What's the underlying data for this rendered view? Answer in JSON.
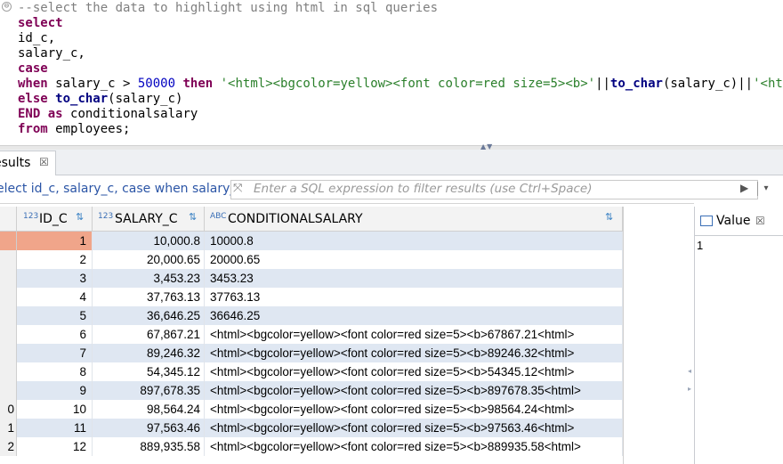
{
  "editor": {
    "fold_symbol": "⊖",
    "lines": [
      {
        "segments": [
          {
            "t": "--select the data to highlight using html in sql queries",
            "c": "c-comment"
          }
        ]
      },
      {
        "segments": [
          {
            "t": "select",
            "c": "c-kw"
          }
        ]
      },
      {
        "segments": [
          {
            "t": "id_c,",
            "c": "c-plain"
          }
        ]
      },
      {
        "segments": [
          {
            "t": "salary_c,",
            "c": "c-plain"
          }
        ]
      },
      {
        "segments": [
          {
            "t": "case",
            "c": "c-kw"
          }
        ]
      },
      {
        "segments": [
          {
            "t": "when",
            "c": "c-kw"
          },
          {
            "t": " salary_c > ",
            "c": "c-plain"
          },
          {
            "t": "50000",
            "c": "c-num"
          },
          {
            "t": " ",
            "c": "c-plain"
          },
          {
            "t": "then",
            "c": "c-kw"
          },
          {
            "t": " ",
            "c": "c-plain"
          },
          {
            "t": "'<html><bgcolor=yellow><font color=red size=5><b>'",
            "c": "c-str"
          },
          {
            "t": "||",
            "c": "c-plain"
          },
          {
            "t": "to_char",
            "c": "c-fn"
          },
          {
            "t": "(salary_c)||",
            "c": "c-plain"
          },
          {
            "t": "'<html>'",
            "c": "c-str"
          }
        ]
      },
      {
        "segments": [
          {
            "t": "else",
            "c": "c-kw"
          },
          {
            "t": " ",
            "c": "c-plain"
          },
          {
            "t": "to_char",
            "c": "c-fn"
          },
          {
            "t": "(salary_c)",
            "c": "c-plain"
          }
        ]
      },
      {
        "segments": [
          {
            "t": "END",
            "c": "c-kw"
          },
          {
            "t": " ",
            "c": "c-plain"
          },
          {
            "t": "as",
            "c": "c-kw"
          },
          {
            "t": " conditionalsalary",
            "c": "c-plain"
          }
        ]
      },
      {
        "segments": [
          {
            "t": "from",
            "c": "c-kw"
          },
          {
            "t": " employees;",
            "c": "c-plain"
          }
        ]
      }
    ]
  },
  "results_tab": {
    "label": "esults",
    "close": "☒"
  },
  "filter": {
    "query_text": "elect id_c, salary_c, case when salary_c",
    "filter_icon": "⤧",
    "placeholder": "Enter a SQL expression to filter results (use Ctrl+Space)",
    "run_icon": "▶",
    "dropdown_icon": "▾"
  },
  "grid": {
    "columns": [
      {
        "type_icon": "123",
        "label": "ID_C",
        "sort_icon": "⇅"
      },
      {
        "type_icon": "123",
        "label": "SALARY_C",
        "sort_icon": "⇅"
      },
      {
        "type_icon": "ABC",
        "label": "CONDITIONALSALARY",
        "sort_icon": "⇅"
      }
    ],
    "rows": [
      {
        "idx": "",
        "id": "1",
        "salary": "10,000.8",
        "cond": "10000.8"
      },
      {
        "idx": "",
        "id": "2",
        "salary": "20,000.65",
        "cond": "20000.65"
      },
      {
        "idx": "",
        "id": "3",
        "salary": "3,453.23",
        "cond": "3453.23"
      },
      {
        "idx": "",
        "id": "4",
        "salary": "37,763.13",
        "cond": "37763.13"
      },
      {
        "idx": "",
        "id": "5",
        "salary": "36,646.25",
        "cond": "36646.25"
      },
      {
        "idx": "",
        "id": "6",
        "salary": "67,867.21",
        "cond": "<html><bgcolor=yellow><font color=red size=5><b>67867.21<html>"
      },
      {
        "idx": "",
        "id": "7",
        "salary": "89,246.32",
        "cond": "<html><bgcolor=yellow><font color=red size=5><b>89246.32<html>"
      },
      {
        "idx": "",
        "id": "8",
        "salary": "54,345.12",
        "cond": "<html><bgcolor=yellow><font color=red size=5><b>54345.12<html>"
      },
      {
        "idx": "",
        "id": "9",
        "salary": "897,678.35",
        "cond": "<html><bgcolor=yellow><font color=red size=5><b>897678.35<html>"
      },
      {
        "idx": "0",
        "id": "10",
        "salary": "98,564.24",
        "cond": "<html><bgcolor=yellow><font color=red size=5><b>98564.24<html>"
      },
      {
        "idx": "1",
        "id": "11",
        "salary": "97,563.46",
        "cond": "<html><bgcolor=yellow><font color=red size=5><b>97563.46<html>"
      },
      {
        "idx": "2",
        "id": "12",
        "salary": "889,935.58",
        "cond": "<html><bgcolor=yellow><font color=red size=5><b>889935.58<html>"
      }
    ]
  },
  "value_panel": {
    "label": "Value",
    "close": "☒",
    "content": "1"
  },
  "colors": {
    "keyword": "#7f0055",
    "string": "#2a7f2a",
    "number": "#0000c0",
    "row_alt": "#dfe7f2",
    "selected": "#f0a58a"
  }
}
